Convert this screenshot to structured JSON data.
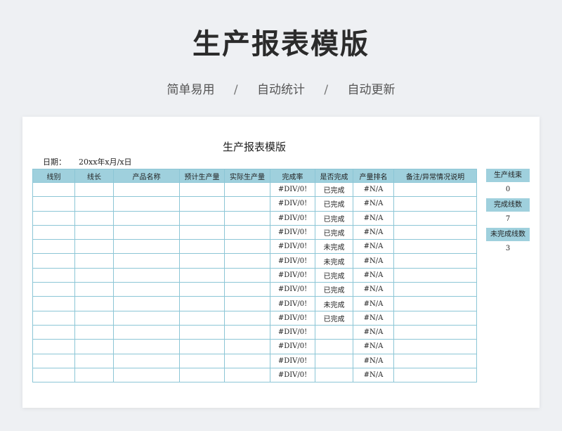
{
  "hero": {
    "title": "生产报表模版",
    "features": [
      "简单易用",
      "自动统计",
      "自动更新"
    ],
    "separator": "/"
  },
  "sheet": {
    "title": "生产报表模版",
    "date_label": "日期：",
    "date_value": "20xx年x月/x日",
    "columns": [
      "线别",
      "线长",
      "产品名称",
      "预计生产量",
      "实际生产量",
      "完成率",
      "是否完成",
      "产量排名",
      "备注/异常情况说明"
    ],
    "rows": [
      [
        "",
        "",
        "",
        "",
        "",
        "#DIV/0!",
        "已完成",
        "#N/A",
        ""
      ],
      [
        "",
        "",
        "",
        "",
        "",
        "#DIV/0!",
        "已完成",
        "#N/A",
        ""
      ],
      [
        "",
        "",
        "",
        "",
        "",
        "#DIV/0!",
        "已完成",
        "#N/A",
        ""
      ],
      [
        "",
        "",
        "",
        "",
        "",
        "#DIV/0!",
        "已完成",
        "#N/A",
        ""
      ],
      [
        "",
        "",
        "",
        "",
        "",
        "#DIV/0!",
        "未完成",
        "#N/A",
        ""
      ],
      [
        "",
        "",
        "",
        "",
        "",
        "#DIV/0!",
        "未完成",
        "#N/A",
        ""
      ],
      [
        "",
        "",
        "",
        "",
        "",
        "#DIV/0!",
        "已完成",
        "#N/A",
        ""
      ],
      [
        "",
        "",
        "",
        "",
        "",
        "#DIV/0!",
        "已完成",
        "#N/A",
        ""
      ],
      [
        "",
        "",
        "",
        "",
        "",
        "#DIV/0!",
        "未完成",
        "#N/A",
        ""
      ],
      [
        "",
        "",
        "",
        "",
        "",
        "#DIV/0!",
        "已完成",
        "#N/A",
        ""
      ],
      [
        "",
        "",
        "",
        "",
        "",
        "#DIV/0!",
        "",
        "#N/A",
        ""
      ],
      [
        "",
        "",
        "",
        "",
        "",
        "#DIV/0!",
        "",
        "#N/A",
        ""
      ],
      [
        "",
        "",
        "",
        "",
        "",
        "#DIV/0!",
        "",
        "#N/A",
        ""
      ],
      [
        "",
        "",
        "",
        "",
        "",
        "#DIV/0!",
        "",
        "#N/A",
        ""
      ]
    ],
    "summary": [
      {
        "label": "生产线束",
        "value": "0"
      },
      {
        "label": "完成线数",
        "value": "7"
      },
      {
        "label": "未完成线数",
        "value": "3"
      }
    ]
  },
  "colors": {
    "header_bg": "#9fd0dd",
    "border": "#8cc6d6",
    "page_bg": "#eef0f3"
  }
}
